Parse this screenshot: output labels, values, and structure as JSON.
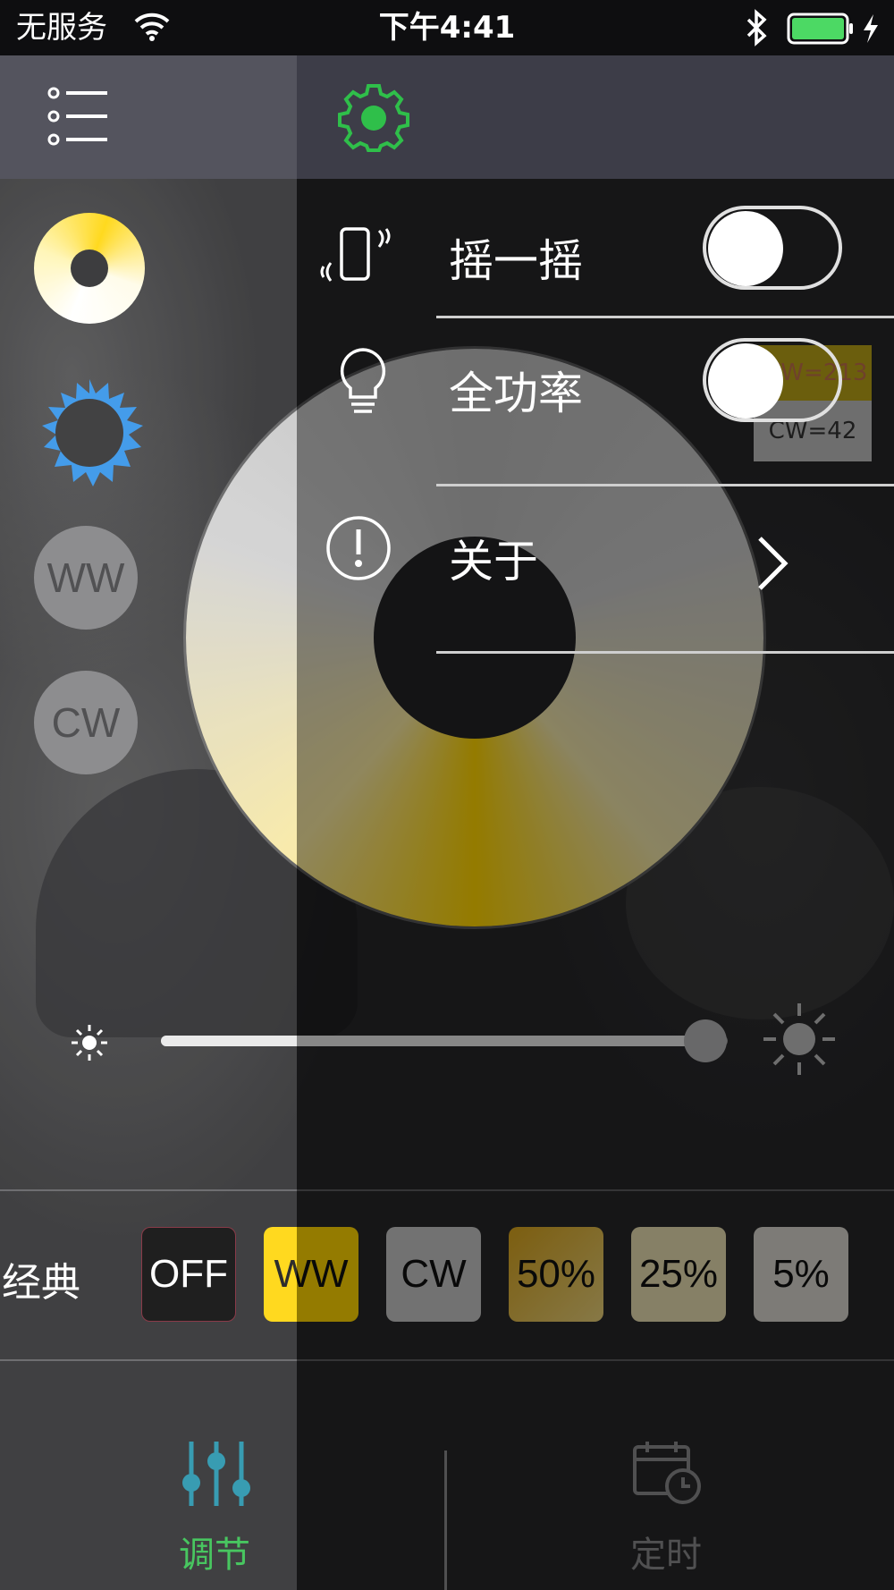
{
  "status_bar": {
    "carrier": "无服务",
    "time": "下午4:41",
    "icons": [
      "wifi-icon",
      "bluetooth-icon",
      "battery-icon",
      "charging-icon"
    ]
  },
  "header": {
    "icons": [
      "menu-list-icon",
      "settings-gear-icon"
    ],
    "gear_color": "#2fbf4a"
  },
  "side_buttons": {
    "icons": [
      "color-ring-icon",
      "sun-icon"
    ],
    "ww_label": "WW",
    "cw_label": "CW"
  },
  "menu": {
    "items": [
      {
        "icon": "shake-phone-icon",
        "label": "摇一摇",
        "control": "toggle",
        "on": false
      },
      {
        "icon": "bulb-icon",
        "label": "全功率",
        "control": "toggle",
        "on": false
      },
      {
        "icon": "info-icon",
        "label": "关于",
        "control": "chevron"
      }
    ]
  },
  "readout": {
    "ww": "WW=213",
    "cw": "CW=42"
  },
  "brightness": {
    "value": 0.96,
    "icons": [
      "brightness-low-icon",
      "brightness-high-icon"
    ]
  },
  "presets": {
    "label": "经典",
    "buttons": [
      "OFF",
      "WW",
      "CW",
      "50%",
      "25%",
      "5%"
    ]
  },
  "tabbar": {
    "tabs": [
      {
        "label": "调节",
        "icon": "sliders-icon",
        "active": true
      },
      {
        "label": "定时",
        "icon": "calendar-clock-icon",
        "active": false
      }
    ]
  },
  "colors": {
    "accent_green": "#2fbf4a",
    "accent_blue": "#2b8fe8",
    "warm_yellow": "#ffd400",
    "tab_icon_teal": "#1d8fa8"
  }
}
